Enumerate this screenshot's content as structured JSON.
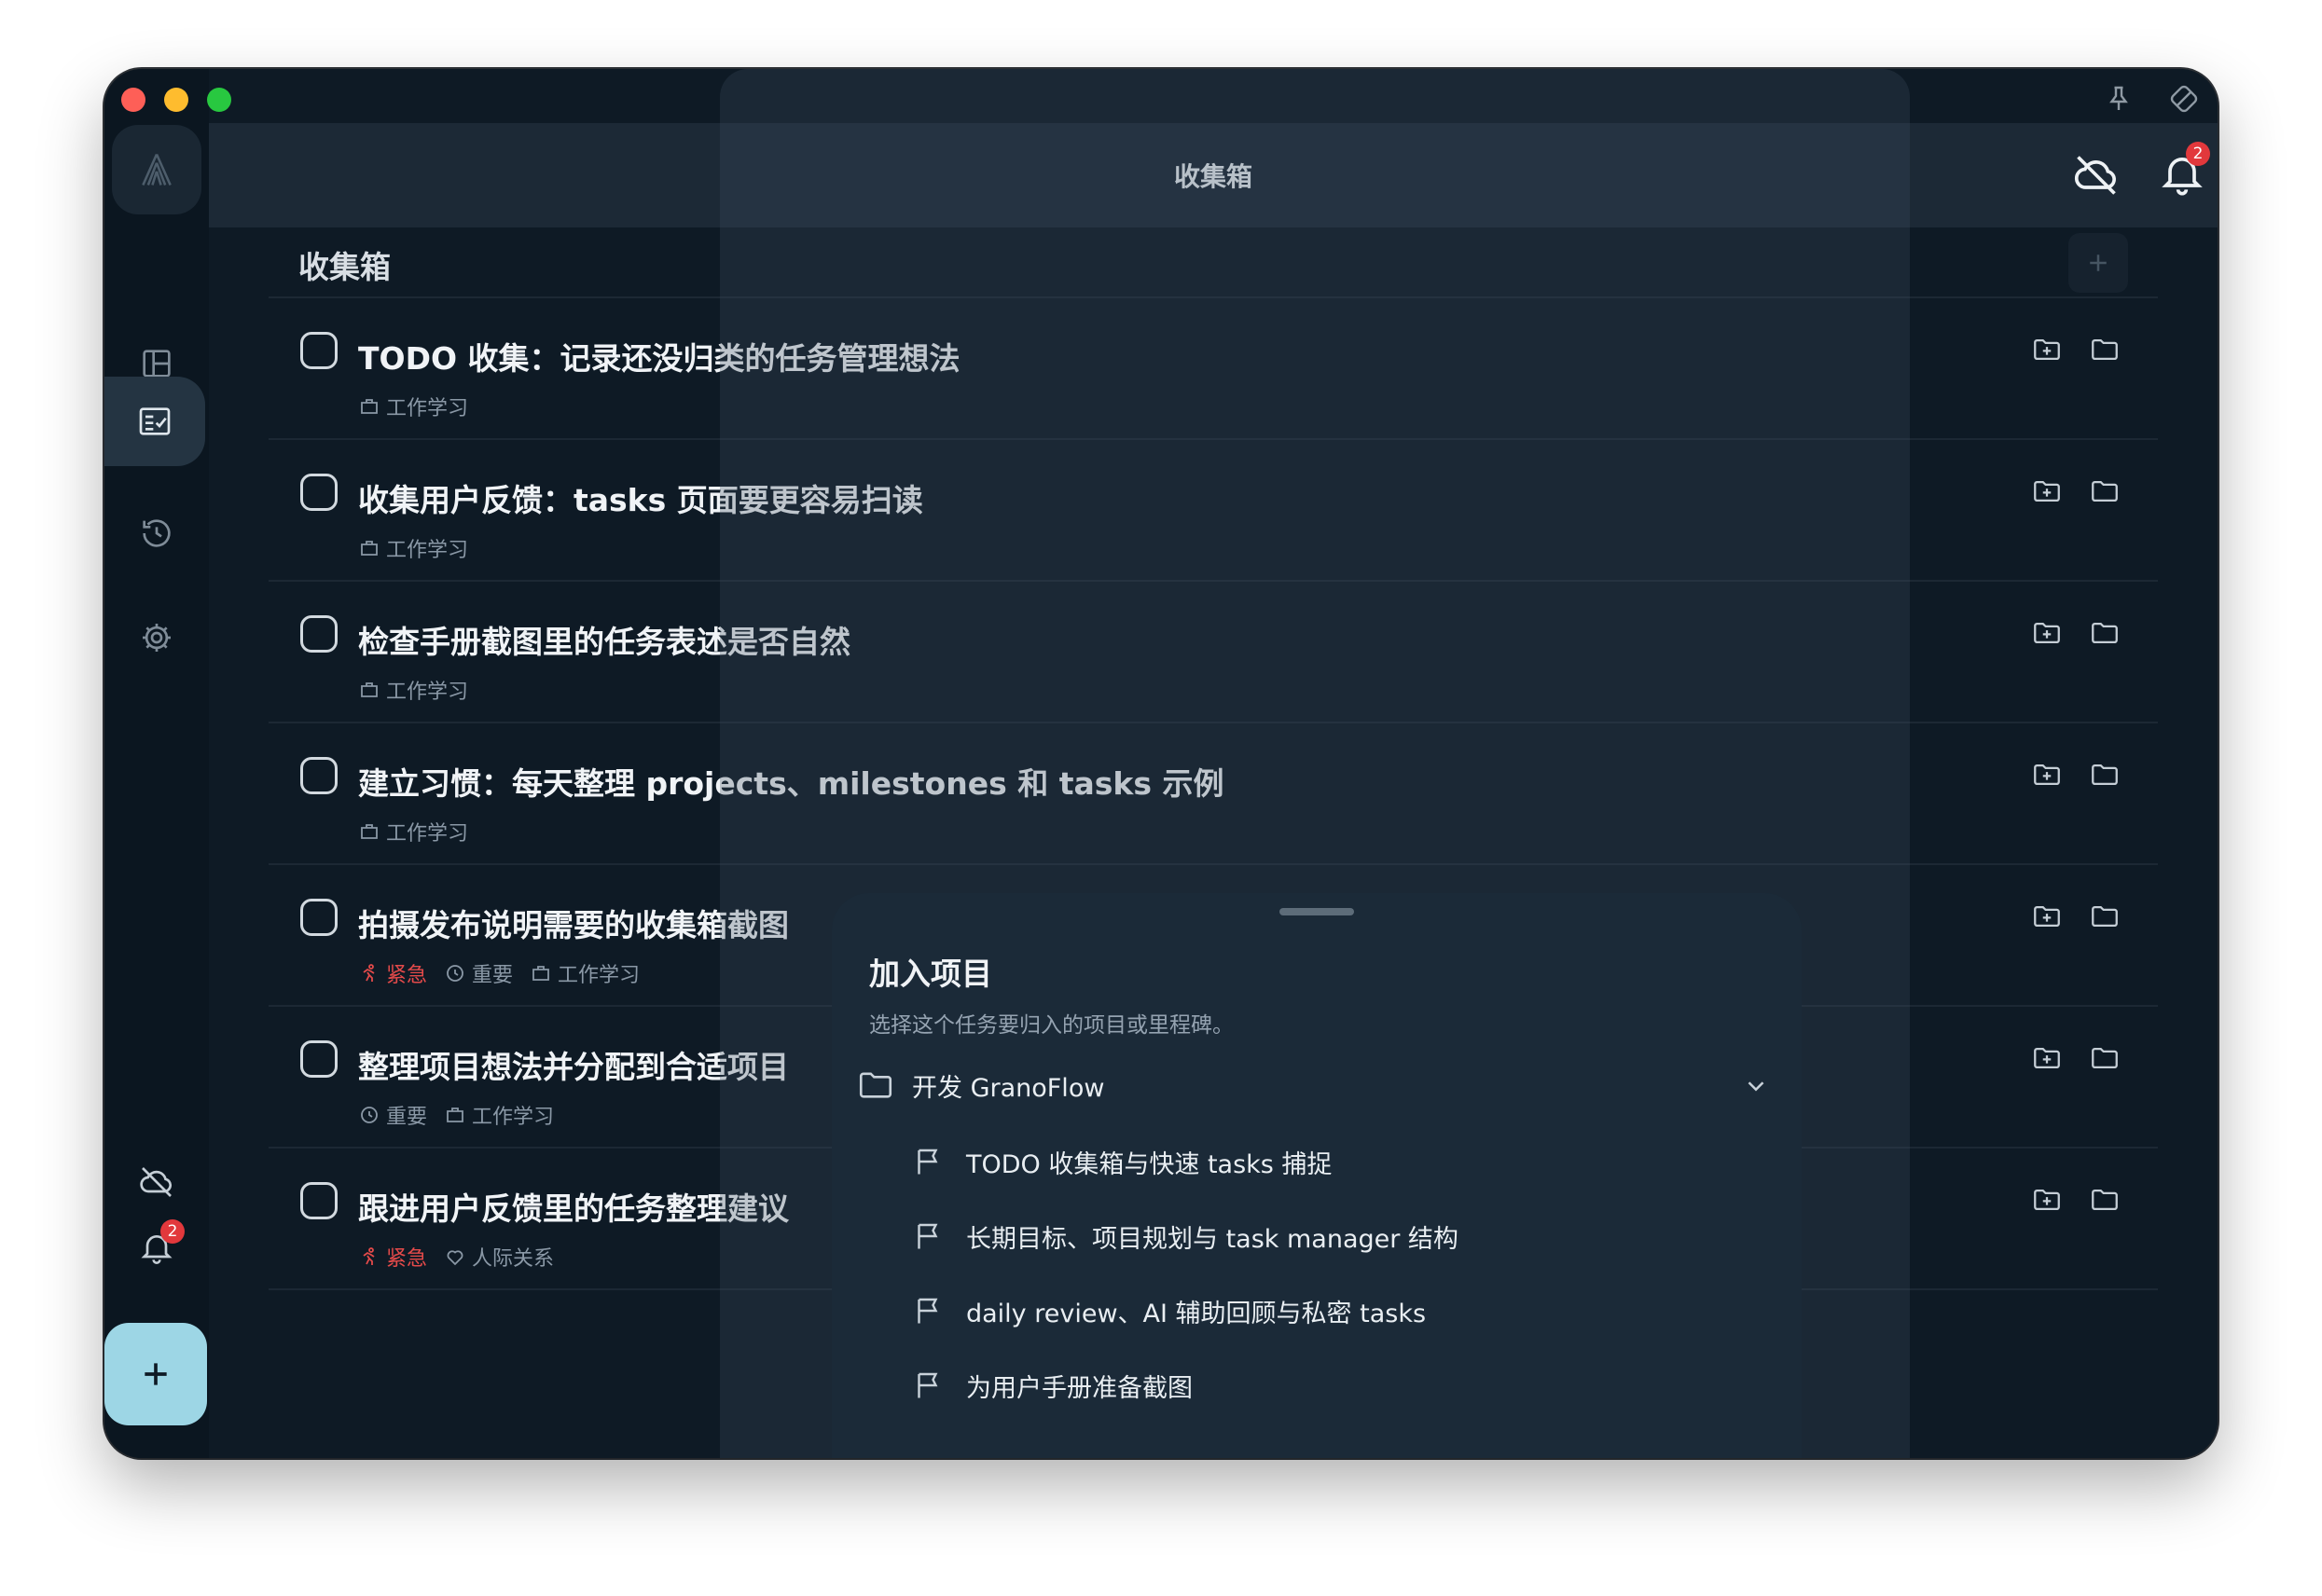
{
  "window": {
    "title": "收集箱"
  },
  "sidebar": {
    "items": [
      {
        "name": "overview",
        "icon": "layout-icon"
      },
      {
        "name": "inbox",
        "icon": "checklist-icon",
        "active": true
      },
      {
        "name": "history",
        "icon": "history-icon"
      },
      {
        "name": "settings",
        "icon": "gear-icon"
      }
    ],
    "notification_count": "2"
  },
  "header": {
    "title": "收集箱",
    "notification_count": "2"
  },
  "section": {
    "title": "收集箱"
  },
  "tasks": [
    {
      "title": "TODO 收集：记录还没归类的任务管理想法",
      "tags": [
        {
          "icon": "folder-tag",
          "label": "工作学习"
        }
      ]
    },
    {
      "title": "收集用户反馈：tasks 页面要更容易扫读",
      "tags": [
        {
          "icon": "folder-tag",
          "label": "工作学习"
        }
      ]
    },
    {
      "title": "检查手册截图里的任务表述是否自然",
      "tags": [
        {
          "icon": "folder-tag",
          "label": "工作学习"
        }
      ]
    },
    {
      "title": "建立习惯：每天整理 projects、milestones 和 tasks 示例",
      "tags": [
        {
          "icon": "folder-tag",
          "label": "工作学习"
        }
      ]
    },
    {
      "title": "拍摄发布说明需要的收集箱截图",
      "tags": [
        {
          "icon": "run",
          "label": "紧急",
          "urgent": true
        },
        {
          "icon": "clock",
          "label": "重要"
        },
        {
          "icon": "folder-tag",
          "label": "工作学习"
        }
      ]
    },
    {
      "title": "整理项目想法并分配到合适项目",
      "tags": [
        {
          "icon": "clock",
          "label": "重要"
        },
        {
          "icon": "folder-tag",
          "label": "工作学习"
        }
      ]
    },
    {
      "title": "跟进用户反馈里的任务整理建议",
      "tags": [
        {
          "icon": "run",
          "label": "紧急",
          "urgent": true
        },
        {
          "icon": "heart",
          "label": "人际关系"
        }
      ]
    }
  ],
  "sheet": {
    "title": "加入项目",
    "subtitle": "选择这个任务要归入的项目或里程碑。",
    "project": {
      "label": "开发 GranoFlow"
    },
    "milestones": [
      "TODO 收集箱与快速 tasks 捕捉",
      "长期目标、项目规划与 task manager 结构",
      "daily review、AI 辅助回顾与私密 tasks",
      "为用户手册准备截图"
    ]
  },
  "colors": {
    "background": "#0e1a25",
    "header": "#1c2936",
    "sheet": "#1b2a38",
    "fab": "#9dd6e5",
    "urgent": "#e34a4a",
    "badge": "#e2383c"
  }
}
